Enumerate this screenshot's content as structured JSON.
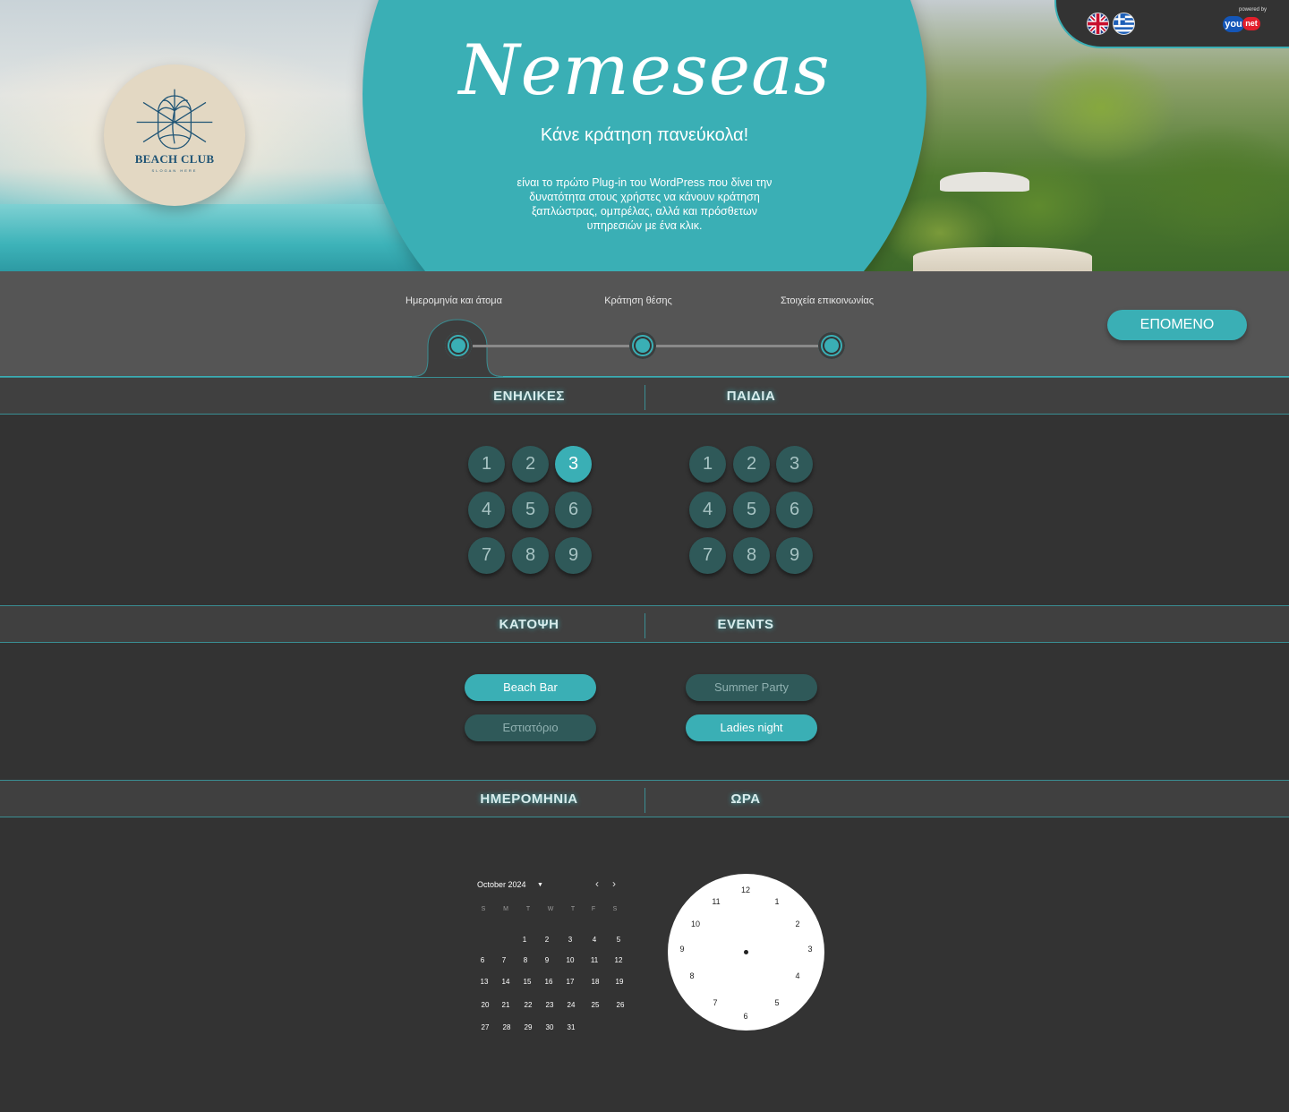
{
  "hero": {
    "brand": "Nemeseas",
    "tagline": "Κάνε κράτηση πανεύκολα!",
    "description": "είναι το πρώτο Plug-in του WordPress που δίνει την δυνατότητα στους χρήστες να κάνουν κράτηση ξαπλώστρας, ομπρέλας, αλλά και πρόσθετων υπηρεσιών με ένα κλικ.",
    "logo_text": "BEACH CLUB",
    "logo_slogan": "SLOGAN HERE"
  },
  "lang": {
    "options": [
      "English",
      "Ελληνικά"
    ],
    "powered_by": "powered by",
    "vendor_you": "you",
    "vendor_net": "net"
  },
  "steps": {
    "items": [
      "Ημερομηνία και άτομα",
      "Κράτηση θέσης",
      "Στοιχεία επικοινωνίας"
    ],
    "active_index": 0,
    "next_label": "ΕΠΟΜΕΝΟ"
  },
  "people": {
    "adults_title": "ΕΝΗΛΙΚΕΣ",
    "children_title": "ΠΑΙΔΙΑ",
    "adults": [
      "1",
      "2",
      "3",
      "4",
      "5",
      "6",
      "7",
      "8",
      "9"
    ],
    "children": [
      "1",
      "2",
      "3",
      "4",
      "5",
      "6",
      "7",
      "8",
      "9"
    ],
    "adults_selected": "3",
    "children_selected": null
  },
  "areas": {
    "floor_title": "ΚΑΤΟΨΗ",
    "events_title": "EVENTS",
    "floor": [
      {
        "label": "Beach Bar",
        "selected": true
      },
      {
        "label": "Εστιατόριο",
        "selected": false
      }
    ],
    "events": [
      {
        "label": "Summer Party",
        "selected": false
      },
      {
        "label": "Ladies night",
        "selected": true
      }
    ]
  },
  "datetime": {
    "date_title": "ΗΜΕΡΟΜΗΝΙΑ",
    "time_title": "ΩΡΑ"
  },
  "calendar": {
    "month_label": "October 2024",
    "caret_icon": "caret-down-icon",
    "prev_icon": "chevron-left-icon",
    "next_icon": "chevron-right-icon",
    "weekdays": [
      "S",
      "M",
      "T",
      "W",
      "T",
      "F",
      "S"
    ],
    "weeks": [
      [
        "",
        "",
        "1",
        "2",
        "3",
        "4",
        "5"
      ],
      [
        "6",
        "7",
        "8",
        "9",
        "10",
        "11",
        "12"
      ],
      [
        "13",
        "14",
        "15",
        "16",
        "17",
        "18",
        "19"
      ],
      [
        "20",
        "21",
        "22",
        "23",
        "24",
        "25",
        "26"
      ],
      [
        "27",
        "28",
        "29",
        "30",
        "31",
        "",
        ""
      ]
    ]
  },
  "clock": {
    "numbers": [
      "12",
      "1",
      "2",
      "3",
      "4",
      "5",
      "6",
      "7",
      "8",
      "9",
      "10",
      "11"
    ]
  },
  "colors": {
    "accent": "#3aafb5",
    "background": "#333333",
    "stepbar": "#555555",
    "section_header": "#404040",
    "inactive_chip": "#2f5959"
  }
}
